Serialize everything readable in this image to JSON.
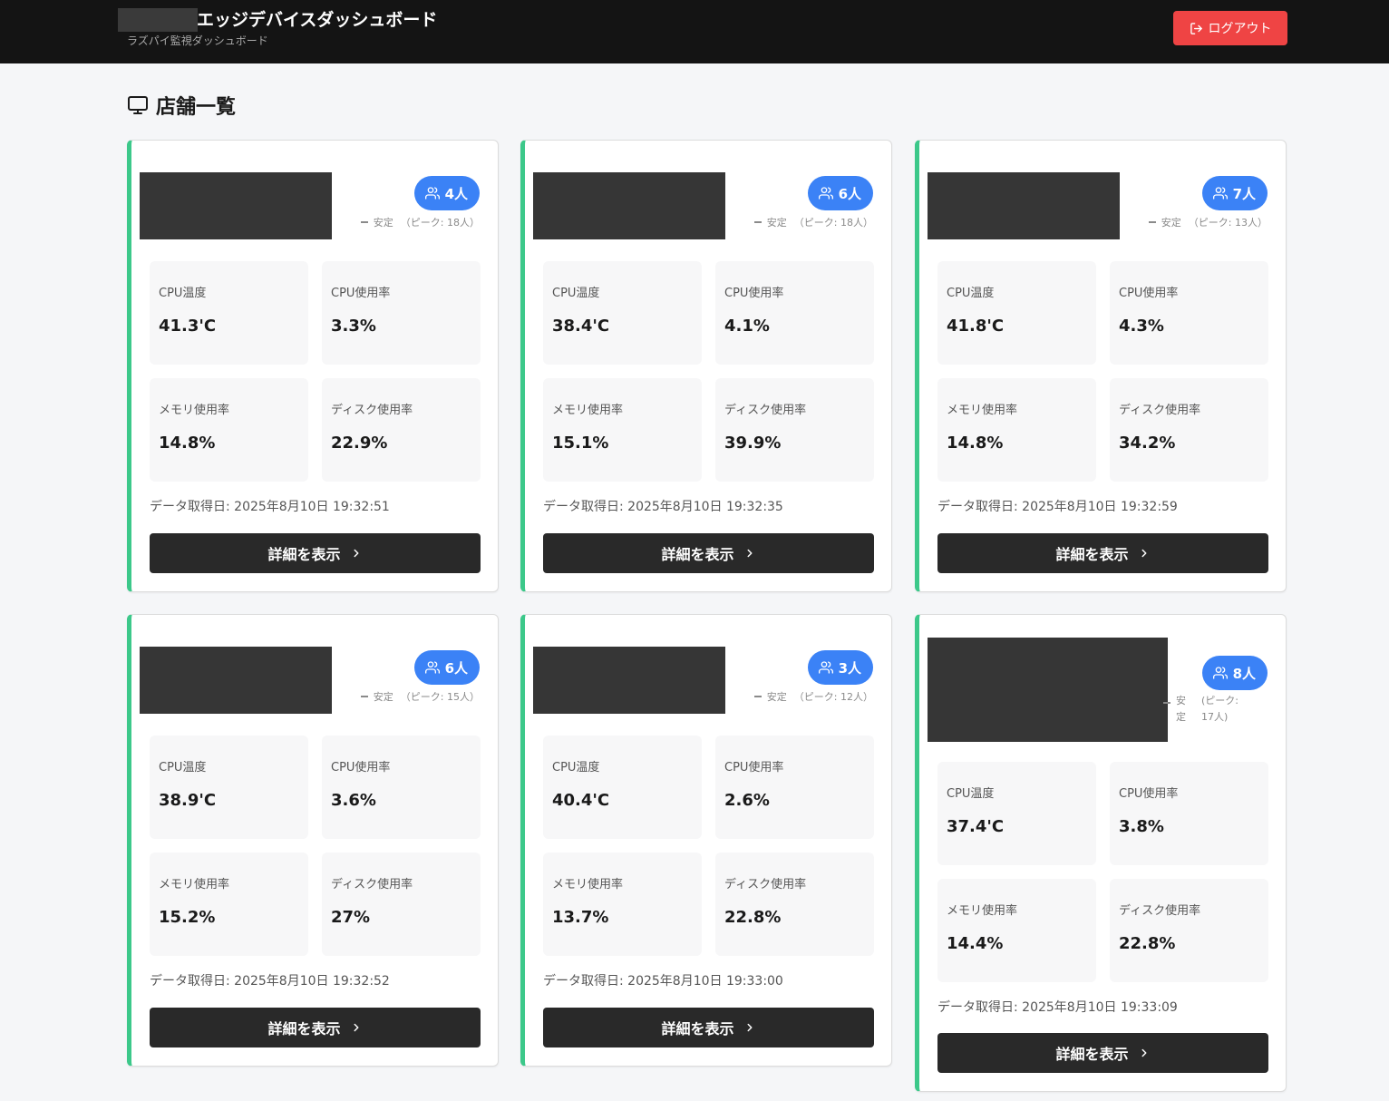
{
  "header": {
    "title": "エッジデバイスダッシュボード",
    "subtitle": "ラズパイ監視ダッシュボード",
    "logout_label": "ログアウト"
  },
  "section": {
    "title": "店舗一覧"
  },
  "labels": {
    "cpu_temp": "CPU温度",
    "cpu_usage": "CPU使用率",
    "memory_usage": "メモリ使用率",
    "disk_usage": "ディスク使用率",
    "details_button": "詳細を表示"
  },
  "colors": {
    "accent_green": "#3cc88a",
    "badge_blue": "#3b82f6",
    "logout_red": "#ef4444"
  },
  "stores": [
    {
      "people": "4人",
      "status": "安定",
      "peak": "（ピーク: 18人）",
      "cpu_temp": "41.3'C",
      "cpu_usage": "3.3%",
      "memory_usage": "14.8%",
      "disk_usage": "22.9%",
      "fetched": "データ取得日: 2025年8月10日 19:32:51"
    },
    {
      "people": "6人",
      "status": "安定",
      "peak": "（ピーク: 18人）",
      "cpu_temp": "38.4'C",
      "cpu_usage": "4.1%",
      "memory_usage": "15.1%",
      "disk_usage": "39.9%",
      "fetched": "データ取得日: 2025年8月10日 19:32:35"
    },
    {
      "people": "7人",
      "status": "安定",
      "peak": "（ピーク: 13人）",
      "cpu_temp": "41.8'C",
      "cpu_usage": "4.3%",
      "memory_usage": "14.8%",
      "disk_usage": "34.2%",
      "fetched": "データ取得日: 2025年8月10日 19:32:59"
    },
    {
      "people": "6人",
      "status": "安定",
      "peak": "（ピーク: 15人）",
      "cpu_temp": "38.9'C",
      "cpu_usage": "3.6%",
      "memory_usage": "15.2%",
      "disk_usage": "27%",
      "fetched": "データ取得日: 2025年8月10日 19:32:52"
    },
    {
      "people": "3人",
      "status": "安定",
      "peak": "（ピーク: 12人）",
      "cpu_temp": "40.4'C",
      "cpu_usage": "2.6%",
      "memory_usage": "13.7%",
      "disk_usage": "22.8%",
      "fetched": "データ取得日: 2025年8月10日 19:33:00"
    },
    {
      "people": "8人",
      "status": "安定",
      "peak": "(ピーク: 17人)",
      "cpu_temp": "37.4'C",
      "cpu_usage": "3.8%",
      "memory_usage": "14.4%",
      "disk_usage": "22.8%",
      "fetched": "データ取得日: 2025年8月10日 19:33:09"
    }
  ]
}
